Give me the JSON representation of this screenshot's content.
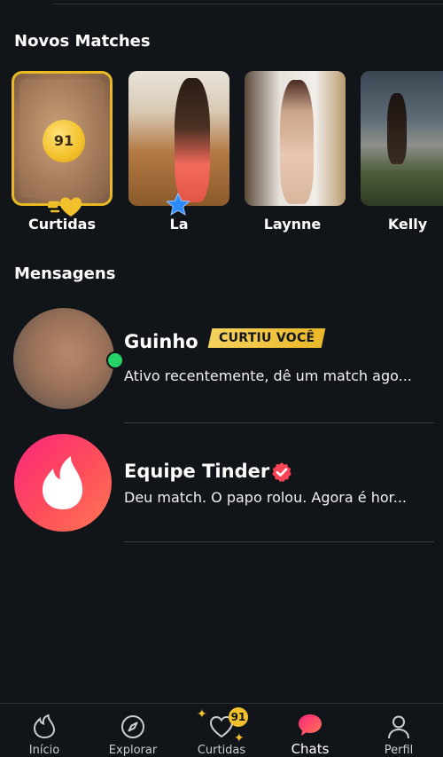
{
  "sections": {
    "new_matches_title": "Novos Matches",
    "messages_title": "Mensagens"
  },
  "new_matches": {
    "likes": {
      "count": "91",
      "label": "Curtidas"
    },
    "matches": [
      {
        "name": "La",
        "super_like": true
      },
      {
        "name": "Laynne"
      },
      {
        "name": "Kelly"
      }
    ]
  },
  "messages": [
    {
      "name": "Guinho",
      "badge": "CURTIU VOCÊ",
      "preview": "Ativo recentemente, dê um match ago...",
      "online": true
    },
    {
      "name": "Equipe Tinder",
      "verified": true,
      "preview": "Deu match. O papo rolou. Agora é hor..."
    }
  ],
  "bottom_nav": {
    "items": [
      {
        "label": "Início",
        "icon": "flame-icon"
      },
      {
        "label": "Explorar",
        "icon": "compass-icon"
      },
      {
        "label": "Curtidas",
        "icon": "heart-icon",
        "badge": "91"
      },
      {
        "label": "Chats",
        "icon": "chat-icon",
        "active": true
      },
      {
        "label": "Perfil",
        "icon": "person-icon"
      }
    ]
  },
  "colors": {
    "background": "#111418",
    "gold": "#f2c12b",
    "tinder_gradient_start": "#fd267d",
    "tinder_gradient_end": "#ff7854",
    "online": "#25d366",
    "superlike": "#2f8cff"
  }
}
